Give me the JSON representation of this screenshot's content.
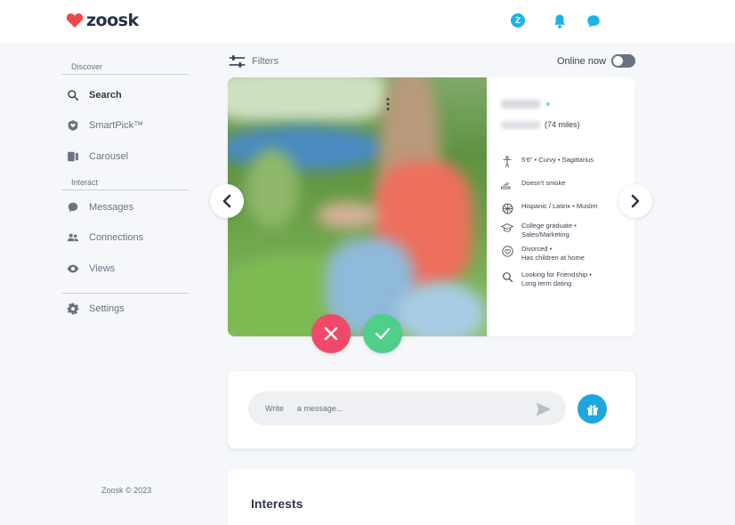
{
  "header": {
    "brand": "zoosk",
    "avatar_initial": "Z",
    "colors": {
      "brand": "#f0474f",
      "accent": "#1fb3e5"
    }
  },
  "sidebar": {
    "discover_label": "Discover",
    "interact_label": "Interact",
    "items": [
      {
        "label": "Search",
        "icon": "search-icon",
        "active": true
      },
      {
        "label": "SmartPick™",
        "icon": "smartpick-icon"
      },
      {
        "label": "Carousel",
        "icon": "carousel-icon"
      },
      {
        "label": "Messages",
        "icon": "chat-bubble-icon"
      },
      {
        "label": "Connections",
        "icon": "people-icon"
      },
      {
        "label": "Views",
        "icon": "eye-icon"
      },
      {
        "label": "Settings",
        "icon": "gear-icon"
      }
    ],
    "copyright": "Zoosk © 2023"
  },
  "toolbar": {
    "filters_label": "Filters",
    "online_now_label": "Online now",
    "online_now_on": false
  },
  "profile": {
    "distance": "(74 miles)",
    "details": [
      {
        "icon": "height-icon",
        "lines": [
          "5'6\"  •  Curvy  •  Sagittarius"
        ]
      },
      {
        "icon": "smoking-icon",
        "lines": [
          "Doesn't smoke"
        ]
      },
      {
        "icon": "globe-icon",
        "lines": [
          "Hispanic / Latinx  •  Muslim"
        ]
      },
      {
        "icon": "graduation-cap-icon",
        "lines": [
          "College graduate  •",
          "Sales/Marketing"
        ]
      },
      {
        "icon": "heart-outline-icon",
        "lines": [
          "Divorced  •",
          "Has children at home"
        ]
      },
      {
        "icon": "magnifier-icon",
        "lines": [
          "Looking for Friendship  •",
          "Long term dating"
        ]
      }
    ]
  },
  "message": {
    "placeholder": "Write      a message..."
  },
  "interests": {
    "title": "Interests"
  }
}
